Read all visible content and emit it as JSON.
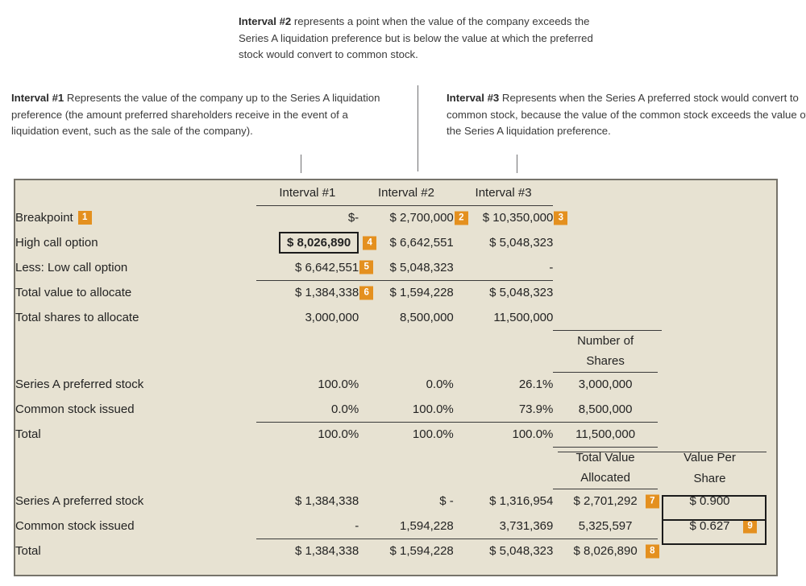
{
  "annotations": [
    {
      "id": 1,
      "lead": "Interval #1",
      "text": " Represents the value of the company up to the Series A liquidation preference (the amount preferred shareholders receive in the event of a liquidation event, such as the sale of the company)."
    },
    {
      "id": 2,
      "lead": "Interval #2",
      "text": " represents a point when the value of the company exceeds the Series A liquidation preference but is below the value at which the preferred stock would convert to common stock."
    },
    {
      "id": 3,
      "lead": "Interval #3",
      "text": " Represents when the Series A preferred stock would convert to common stock, because the value of the common stock exceeds the value of the Series A liquidation preference."
    }
  ],
  "colors": {
    "panel_background": "#E7E2D2",
    "panel_border": "#76736a",
    "badge": "#E4901F",
    "text": "#232323",
    "rule": "#3a3a3a"
  },
  "table": {
    "interval_headers": [
      "Interval #1",
      "Interval #2",
      "Interval #3"
    ],
    "shares_header_line1": "Number of",
    "shares_header_line2": "Shares",
    "total_value_header_line1": "Total Value",
    "total_value_header_line2": "Allocated",
    "value_per_share_header_line1": "Value Per",
    "value_per_share_header_line2": "Share",
    "section_a": [
      {
        "label": "Breakpoint",
        "label_badge": "1",
        "i1": "$-",
        "i2": "$ 2,700,000",
        "i2_badge": "2",
        "i3": "$ 10,350,000",
        "i3_badge": "3"
      },
      {
        "label": "High call option",
        "i1": "$ 8,026,890",
        "i1_badge": "4",
        "i2": "$ 6,642,551",
        "i3": "$ 5,048,323"
      },
      {
        "label": "Less: Low call option",
        "i1": "$ 6,642,551",
        "i1_badge": "5",
        "i2": "$ 5,048,323",
        "i3": "-"
      },
      {
        "label": "Total value to allocate",
        "i1": "$ 1,384,338",
        "i1_badge": "6",
        "i2": "$ 1,594,228",
        "i3": "$ 5,048,323"
      },
      {
        "label": "Total shares to allocate",
        "i1": "3,000,000",
        "i2": "8,500,000",
        "i3": "11,500,000"
      }
    ],
    "section_b": [
      {
        "label": "Series A preferred stock",
        "i1": "100.0%",
        "i2": "0.0%",
        "i3": "26.1%",
        "shares": "3,000,000"
      },
      {
        "label": "Common stock issued",
        "i1": "0.0%",
        "i2": "100.0%",
        "i3": "73.9%",
        "shares": "8,500,000"
      },
      {
        "label": "Total",
        "i1": "100.0%",
        "i2": "100.0%",
        "i3": "100.0%",
        "shares": "11,500,000"
      }
    ],
    "section_c": [
      {
        "label": "Series A preferred stock",
        "i1": "$ 1,384,338",
        "i2": "$ -",
        "i3": "$ 1,316,954",
        "total_value": "$ 2,701,292",
        "total_value_badge": "7",
        "vps": "$ 0.900"
      },
      {
        "label": "Common stock issued",
        "i1": "-",
        "i2": "1,594,228",
        "i3": "3,731,369",
        "total_value": "5,325,597",
        "vps": "$ 0.627",
        "vps_badge": "9"
      },
      {
        "label": "Total",
        "i1": "$ 1,384,338",
        "i2": "$ 1,594,228",
        "i3": "$ 5,048,323",
        "total_value": "$ 8,026,890",
        "total_value_badge": "8",
        "vps": ""
      }
    ]
  }
}
